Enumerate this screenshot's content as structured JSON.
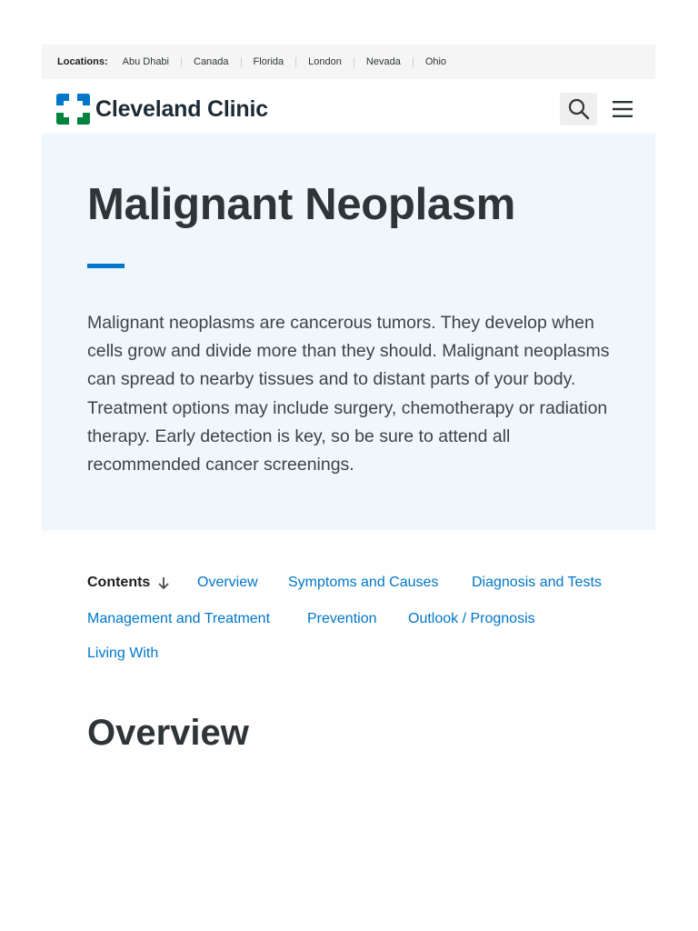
{
  "locations": {
    "label": "Locations:",
    "items": [
      "Abu Dhabi",
      "Canada",
      "Florida",
      "London",
      "Nevada",
      "Ohio"
    ]
  },
  "header": {
    "logo_text": "Cleveland Clinic",
    "search_icon": "search-icon",
    "menu_icon": "hamburger-menu-icon"
  },
  "hero": {
    "title": "Malignant Neoplasm",
    "description": "Malignant neoplasms are cancerous tumors. They develop when cells grow and divide more than they should. Malignant neoplasms can spread to nearby tissues and to distant parts of your body. Treatment options may include surgery, chemotherapy or radiation therapy. Early detection is key, so be sure to attend all recommended cancer screenings."
  },
  "contents": {
    "label": "Contents",
    "links": [
      "Overview",
      "Symptoms and Causes",
      "Diagnosis and Tests",
      "Management and Treatment",
      "Prevention",
      "Outlook / Prognosis",
      "Living With"
    ]
  },
  "main": {
    "section_heading": "Overview"
  },
  "colors": {
    "accent_blue": "#0077c8",
    "hero_bg": "#eff7fc",
    "logo_blue": "#0077c8",
    "logo_green": "#00843d"
  }
}
